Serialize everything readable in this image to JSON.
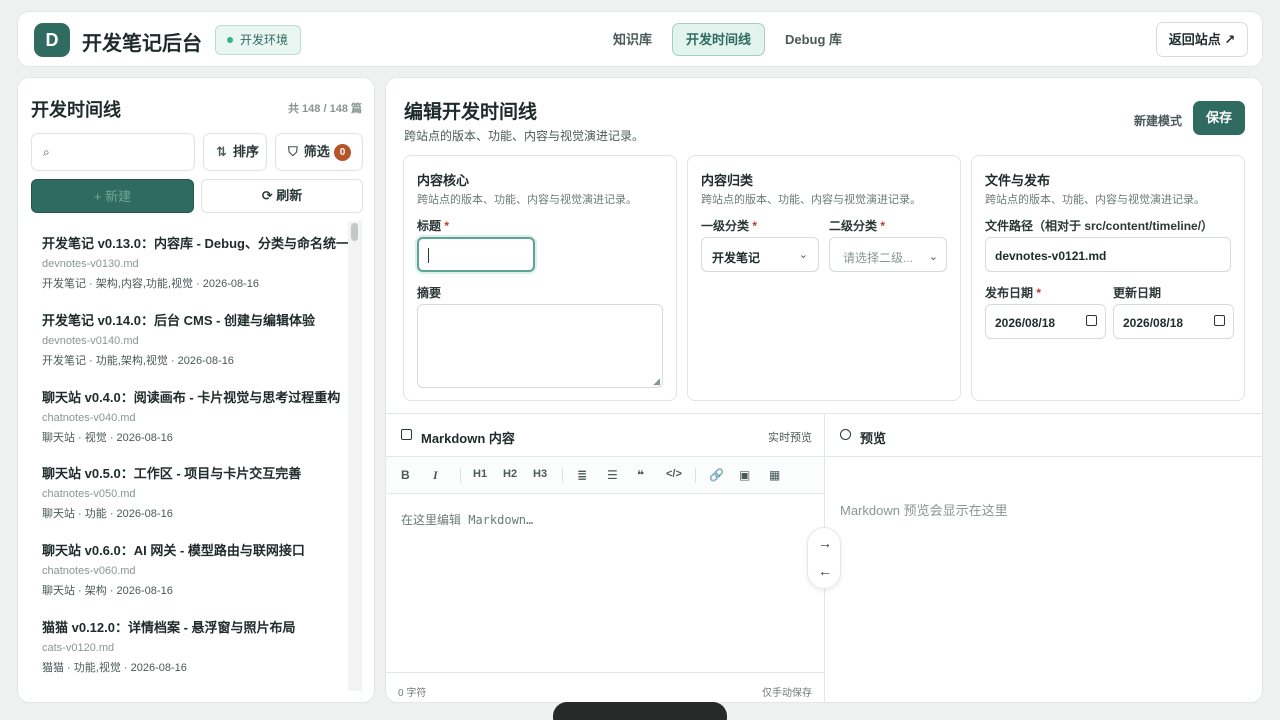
{
  "header": {
    "logo_letter": "D",
    "brand": "开发笔记后台",
    "env_badge": "开发环境",
    "nav": [
      "知识库",
      "开发时间线",
      "Debug 库"
    ],
    "active_nav": "开发时间线",
    "back_label": "返回站点 ↗"
  },
  "sidebar": {
    "title": "开发时间线",
    "count": "共 148 / 148 篇",
    "search_icon": "⌕",
    "sort_icon": "⇅",
    "sort_label": "排序",
    "filter_icon": "⛉",
    "filter_label": "筛选",
    "filter_count": "0",
    "new_label": "+ 新建",
    "refresh_label": "⟳ 刷新",
    "items": [
      {
        "title": "开发笔记 v0.13.0：内容库 - Debug、分类与命名统一",
        "file": "devnotes-v0130.md",
        "meta": "开发笔记 · 架构,内容,功能,视觉 · 2026-08-16"
      },
      {
        "title": "开发笔记 v0.14.0：后台 CMS - 创建与编辑体验",
        "file": "devnotes-v0140.md",
        "meta": "开发笔记 · 功能,架构,视觉 · 2026-08-16"
      },
      {
        "title": "聊天站 v0.4.0：阅读画布 - 卡片视觉与思考过程重构",
        "file": "chatnotes-v040.md",
        "meta": "聊天站 · 视觉 · 2026-08-16"
      },
      {
        "title": "聊天站 v0.5.0：工作区 - 项目与卡片交互完善",
        "file": "chatnotes-v050.md",
        "meta": "聊天站 · 功能 · 2026-08-16"
      },
      {
        "title": "聊天站 v0.6.0：AI 网关 - 模型路由与联网接口",
        "file": "chatnotes-v060.md",
        "meta": "聊天站 · 架构 · 2026-08-16"
      },
      {
        "title": "猫猫 v0.12.0：详情档案 - 悬浮窗与照片布局",
        "file": "cats-v0120.md",
        "meta": "猫猫 · 功能,视觉 · 2026-08-16"
      }
    ]
  },
  "main": {
    "title": "编辑开发时间线",
    "subtitle": "跨站点的版本、功能、内容与视觉演进记录。",
    "mode_label": "新建模式",
    "save_label": "保存",
    "core": {
      "title": "内容核心",
      "desc": "跨站点的版本、功能、内容与视觉演进记录。",
      "title_label": "标题",
      "required": "*",
      "title_value": "",
      "summary_label": "摘要",
      "summary_value": ""
    },
    "category": {
      "title": "内容归类",
      "desc": "跨站点的版本、功能、内容与视觉演进记录。",
      "primary_label": "一级分类",
      "primary_value": "开发笔记",
      "secondary_label": "二级分类",
      "secondary_placeholder": "请选择二级..."
    },
    "publish": {
      "title": "文件与发布",
      "desc": "跨站点的版本、功能、内容与视觉演进记录。",
      "path_label": "文件路径（相对于 src/content/timeline/）",
      "path_value": "devnotes-v0121.md",
      "publish_label": "发布日期",
      "publish_value": "2026/08/18",
      "update_label": "更新日期",
      "update_value": "2026/08/18"
    }
  },
  "editor": {
    "title": "Markdown 内容",
    "right": "实时预览",
    "toolbar": [
      "B",
      "I",
      "H1",
      "H2",
      "H3",
      "≣",
      "☰",
      "❝",
      "</>",
      "🔗",
      "▣",
      "▦"
    ],
    "placeholder": "在这里编辑 Markdown…",
    "char_count": "0 字符",
    "save_hint": "仅手动保存"
  },
  "preview": {
    "title": "预览",
    "placeholder": "Markdown 预览会显示在这里"
  },
  "swap": {
    "right": "→",
    "left": "←"
  }
}
